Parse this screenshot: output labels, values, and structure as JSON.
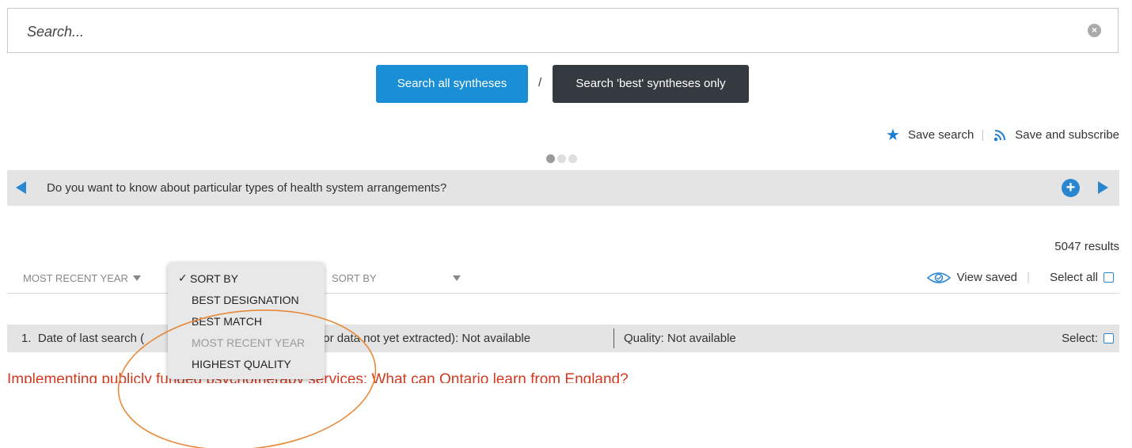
{
  "search": {
    "placeholder": "Search...",
    "clear_icon": "clear-circle-icon"
  },
  "buttons": {
    "search_all": "Search all syntheses",
    "separator": "/",
    "search_best": "Search 'best' syntheses only"
  },
  "save": {
    "save_search": "Save search",
    "separator": "|",
    "save_subscribe": "Save and subscribe",
    "star_icon": "star-icon",
    "rss_icon": "rss-icon"
  },
  "carousel": {
    "question": "Do you want to know about particular types of health system arrangements?",
    "active_dot": 1,
    "dot_count": 3
  },
  "results": {
    "count": "5047 results"
  },
  "filters": {
    "first_label": "MOST RECENT YEAR",
    "second_label": "SORT BY",
    "view_saved": "View saved",
    "separator": "|",
    "select_all": "Select all"
  },
  "sort_menu": {
    "check": "✓",
    "items": [
      "SORT BY",
      "BEST DESIGNATION",
      "BEST MATCH",
      "MOST RECENT YEAR",
      "HIGHEST QUALITY"
    ],
    "selected_index": 0,
    "disabled_index": 3
  },
  "rows": [
    {
      "number": "1.",
      "text_start": "Date of last search (",
      "text_end": "hesis or data not yet extracted): Not available",
      "quality": "Quality: Not available",
      "select": "Select:",
      "title": "Implementing publicly funded psychotherapy services: What can Ontario learn from England?"
    }
  ],
  "colors": {
    "accent_blue": "#1a8fd6",
    "dark_button": "#343a40",
    "title_red": "#d03a20",
    "annotation_orange": "#e8893a"
  }
}
